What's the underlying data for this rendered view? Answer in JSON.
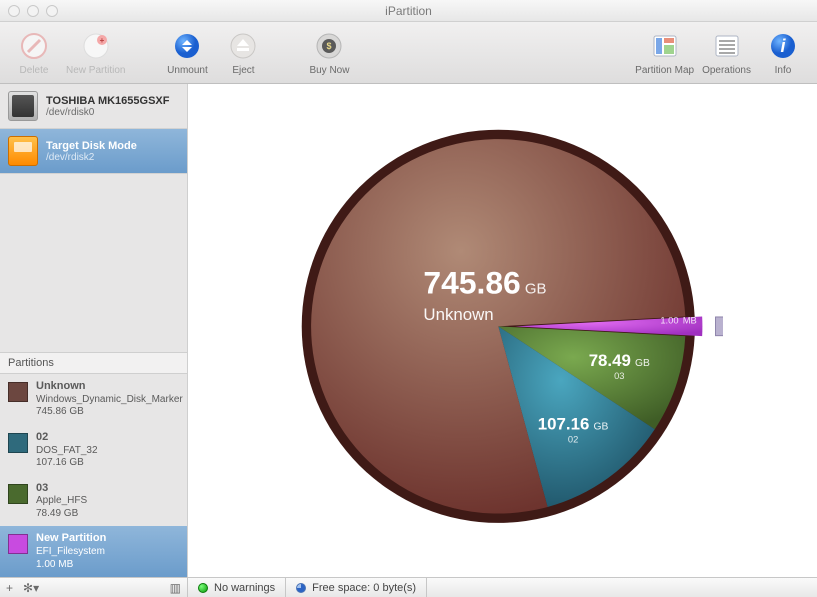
{
  "window": {
    "title": "iPartition"
  },
  "toolbar": {
    "delete": "Delete",
    "new_partition": "New Partition",
    "unmount": "Unmount",
    "eject": "Eject",
    "buy_now": "Buy Now",
    "partition_map": "Partition Map",
    "operations": "Operations",
    "info": "Info"
  },
  "disks": [
    {
      "name": "TOSHIBA MK1655GSXF",
      "dev": "/dev/rdisk0",
      "icon": "hdd",
      "selected": false
    },
    {
      "name": "Target Disk Mode",
      "dev": "/dev/rdisk2",
      "icon": "ext",
      "selected": true
    }
  ],
  "partitions_header": "Partitions",
  "partitions": [
    {
      "title": "Unknown",
      "subtitle": "Windows_Dynamic_Disk_Marker",
      "size": "745.86 GB",
      "color": "#6c4740",
      "selected": false
    },
    {
      "title": "02",
      "subtitle": "DOS_FAT_32",
      "size": "107.16 GB",
      "color": "#2f6a7c",
      "selected": false
    },
    {
      "title": "03",
      "subtitle": "Apple_HFS",
      "size": "78.49 GB",
      "color": "#4a6a2e",
      "selected": false
    },
    {
      "title": "New Partition",
      "subtitle": "EFI_Filesystem",
      "size": "1.00 MB",
      "color": "#c84be0",
      "selected": true
    }
  ],
  "status": {
    "warnings": "No warnings",
    "free_space": "Free space: 0 byte(s)"
  },
  "chart_data": {
    "type": "pie",
    "title": "",
    "series": [
      {
        "name": "Unknown",
        "value_gb": 745.86,
        "label": "745.86",
        "unit": "GB",
        "sublabel": "Unknown",
        "color_top": "#b08a76",
        "color_bottom": "#6a2f2a"
      },
      {
        "name": "02",
        "value_gb": 107.16,
        "label": "107.16",
        "unit": "GB",
        "sublabel": "02",
        "color_top": "#4aa6bf",
        "color_bottom": "#1f5468"
      },
      {
        "name": "03",
        "value_gb": 78.49,
        "label": "78.49",
        "unit": "GB",
        "sublabel": "03",
        "color_top": "#7aa94f",
        "color_bottom": "#3f5d26"
      },
      {
        "name": "New Partition",
        "value_gb": 0.001,
        "label": "1.00",
        "unit": "MB",
        "sublabel": "New Partition",
        "color_top": "#e06af0",
        "color_bottom": "#a030c0",
        "exploded": true
      }
    ]
  }
}
